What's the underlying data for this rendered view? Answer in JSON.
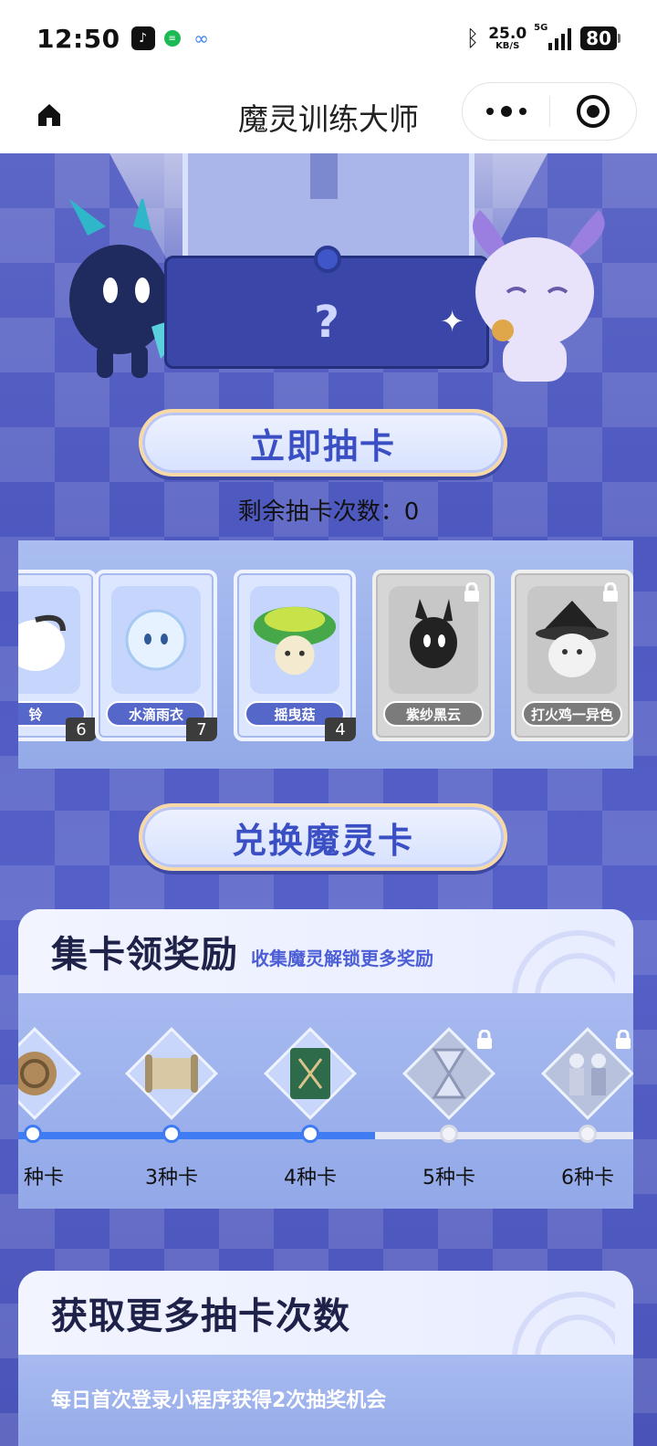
{
  "status_bar": {
    "time": "12:50",
    "speed_value": "25.0",
    "speed_unit": "KB/S",
    "network": "5G",
    "battery": "80",
    "icons": [
      "tiktok-icon",
      "spotify-icon",
      "cloud-icon",
      "bluetooth-icon",
      "signal-icon",
      "battery-icon"
    ]
  },
  "nav": {
    "title": "魔灵训练大师"
  },
  "main": {
    "draw_button": "立即抽卡",
    "remaining_label": "剩余抽卡次数：0",
    "exchange_button": "兑换魔灵卡",
    "cards": [
      {
        "name": "铃",
        "count": "6",
        "locked": false
      },
      {
        "name": "水滴雨衣",
        "count": "7",
        "locked": false
      },
      {
        "name": "摇曳菇",
        "count": "4",
        "locked": false
      },
      {
        "name": "紫纱黑云",
        "count": "",
        "locked": true
      },
      {
        "name": "打火鸡一异色",
        "count": "",
        "locked": true
      }
    ],
    "rewards": {
      "title": "集卡领奖励",
      "subtitle": "收集魔灵解锁更多奖励",
      "tiers": [
        "种卡",
        "3种卡",
        "4种卡",
        "5种卡",
        "6种卡"
      ],
      "unlocked_count": 3,
      "progress": 0.58
    },
    "more_chances": {
      "title": "获取更多抽卡次数",
      "line": "每日首次登录小程序获得2次抽奖机会"
    }
  },
  "colors": {
    "accent": "#3b4fc4",
    "progress": "#3f7bf2",
    "background": "#5a66c8"
  }
}
